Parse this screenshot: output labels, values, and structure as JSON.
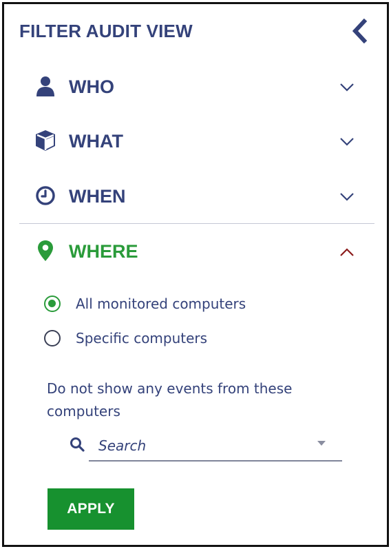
{
  "header": {
    "title": "FILTER AUDIT VIEW",
    "collapse_icon": "chevron-left-icon"
  },
  "sections": [
    {
      "label": "WHO",
      "icon": "user-icon",
      "expanded": false
    },
    {
      "label": "WHAT",
      "icon": "cube-icon",
      "expanded": false
    },
    {
      "label": "WHEN",
      "icon": "clock-icon",
      "expanded": false
    },
    {
      "label": "WHERE",
      "icon": "map-pin-icon",
      "expanded": true
    }
  ],
  "where": {
    "options": [
      {
        "label": "All monitored computers",
        "selected": true
      },
      {
        "label": "Specific computers",
        "selected": false
      }
    ],
    "exclude_label": "Do not show any events from these computers",
    "search": {
      "placeholder": "Search",
      "value": ""
    }
  },
  "actions": {
    "apply_label": "APPLY"
  },
  "colors": {
    "navy": "#34427a",
    "green": "#2a9b3a",
    "apply_bg": "#17912f",
    "chevron_up": "#8b1a1a",
    "divider": "#c5c8d4"
  }
}
